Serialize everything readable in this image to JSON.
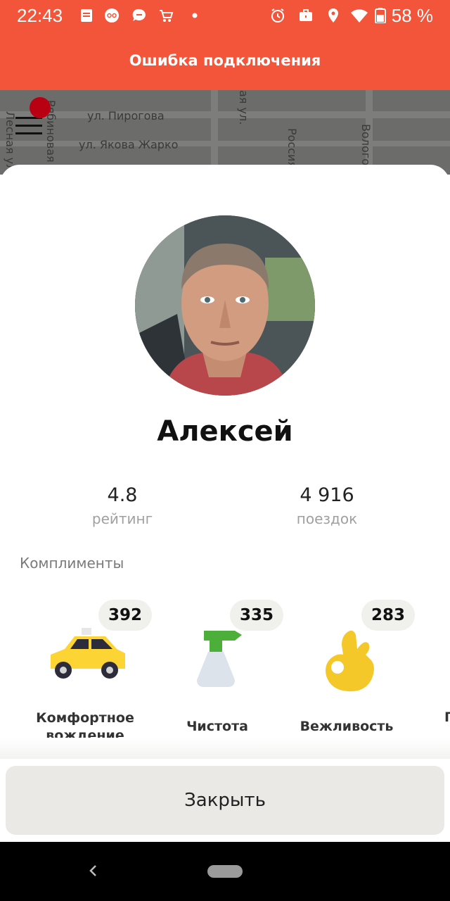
{
  "status_bar": {
    "time": "22:43",
    "battery_percent": "58 %",
    "icons": [
      "notes-icon",
      "voicemail-icon",
      "chat-icon",
      "cart-icon",
      "dot-icon",
      "alarm-icon",
      "briefcase-icon",
      "location-icon",
      "wifi-icon",
      "battery-icon"
    ]
  },
  "banner": {
    "text": "Ошибка подключения",
    "color": "#f2553a"
  },
  "map": {
    "streets": [
      "ул. Пирогова",
      "ул. Якова Жарко",
      "Вологодская",
      "Лесная ул.",
      "Рябиновая ул.",
      "Россия",
      "ая ул."
    ]
  },
  "driver": {
    "name": "Алексей",
    "rating_value": "4.8",
    "rating_label": "рейтинг",
    "trips_value": "4 916",
    "trips_label": "поездок"
  },
  "compliments": {
    "title": "Комплименты",
    "items": [
      {
        "count": "392",
        "label": "Комфортное вождение",
        "icon": "taxi-car-icon"
      },
      {
        "count": "335",
        "label": "Чистота",
        "icon": "spray-bottle-icon"
      },
      {
        "count": "283",
        "label": "Вежливость",
        "icon": "ok-hand-icon"
      }
    ],
    "peek_label": "П"
  },
  "close_button": {
    "label": "Закрыть"
  },
  "colors": {
    "accent": "#f2553a",
    "button_bg": "#ebe9e6",
    "taxi_yellow": "#fcd535"
  }
}
